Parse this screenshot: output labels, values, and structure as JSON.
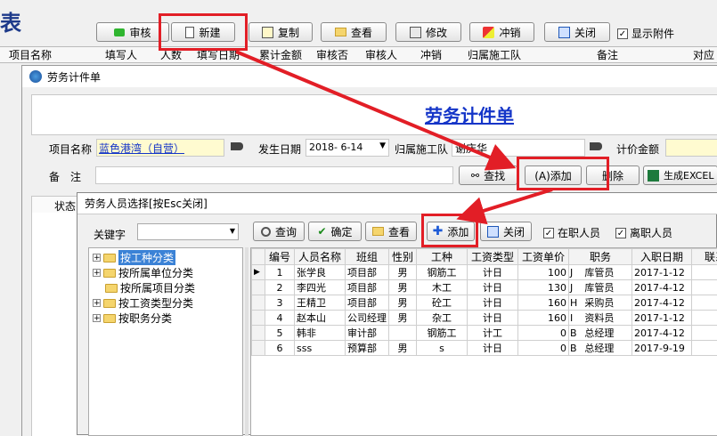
{
  "main": {
    "title_fragment": "表",
    "toolbar": {
      "audit": "审核",
      "new": "新建",
      "copy": "复制",
      "view": "查看",
      "modify": "修改",
      "reverse": "冲销",
      "close": "关闭",
      "show_attachment": "显示附件"
    },
    "columns": [
      "项目名称",
      "填写人",
      "人数",
      "填写日期",
      "累计金额",
      "审核否",
      "审核人",
      "冲销",
      "归属施工队",
      "备注",
      "对应工"
    ]
  },
  "form": {
    "window_title": "劳务计件单",
    "heading": "劳务计件单",
    "project_label": "项目名称",
    "project_value": "蓝色港湾（自营）",
    "date_label": "发生日期",
    "date_value": "2018- 6-14",
    "team_label": "归属施工队",
    "team_value": "谢庆华",
    "amount_label": "计价金额",
    "remark_label": "备　注",
    "find_btn": "查找",
    "add_btn": "(A)添加",
    "delete_btn": "删除",
    "gen_btn": "生成EXCEL",
    "grid_col_status": "状态"
  },
  "dialog": {
    "title": "劳务人员选择[按Esc关闭]",
    "keyword_label": "关键字",
    "buttons": {
      "query": "查询",
      "confirm": "确定",
      "view": "查看",
      "add": "添加",
      "close": "关闭"
    },
    "filters": {
      "in_service": "在职人员",
      "left": "离职人员"
    },
    "tree": [
      "按工种分类",
      "按所属单位分类",
      "按所属项目分类",
      "按工资类型分类",
      "按职务分类"
    ],
    "grid_headers": [
      "编号",
      "人员名称",
      "班组",
      "性别",
      "工种",
      "工资类型",
      "工资单价",
      "职务",
      "入职日期",
      "联系电"
    ],
    "rows": [
      [
        "1",
        "张学良",
        "项目部",
        "男",
        "钢筋工",
        "计日",
        "100",
        "J",
        "库管员",
        "2017-1-12"
      ],
      [
        "2",
        "李四光",
        "项目部",
        "男",
        "木工",
        "计日",
        "130",
        "J",
        "库管员",
        "2017-4-12"
      ],
      [
        "3",
        "王精卫",
        "项目部",
        "男",
        "砼工",
        "计日",
        "160",
        "H",
        "采购员",
        "2017-4-12"
      ],
      [
        "4",
        "赵本山",
        "公司经理",
        "男",
        "杂工",
        "计日",
        "160",
        "I",
        "资料员",
        "2017-1-12"
      ],
      [
        "5",
        "韩非",
        "审计部",
        "",
        "钢筋工",
        "计工",
        "0",
        "B",
        "总经理",
        "2017-4-12"
      ],
      [
        "6",
        "sss",
        "预算部",
        "男",
        "s",
        "计日",
        "0",
        "B",
        "总经理",
        "2017-9-19"
      ]
    ]
  }
}
